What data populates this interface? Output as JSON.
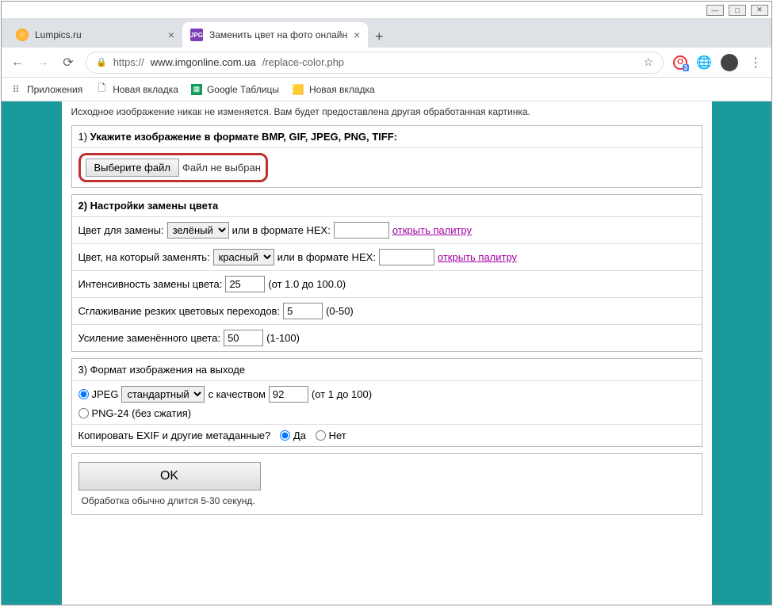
{
  "window": {
    "tabs": [
      {
        "title": "Lumpics.ru"
      },
      {
        "title": "Заменить цвет на фото онлайн"
      }
    ]
  },
  "address": {
    "scheme": "https://",
    "host": "www.imgonline.com.ua",
    "path": "/replace-color.php"
  },
  "bookmarks": {
    "apps": "Приложения",
    "items": [
      "Новая вкладка",
      "Google Таблицы",
      "Новая вкладка"
    ]
  },
  "page": {
    "cutoff": "Исходное изображение никак не изменяется. Вам будет предоставлена другая обработанная картинка.",
    "section1": {
      "title_prefix": "1) ",
      "title_bold": "Укажите изображение в формате BMP, GIF, JPEG, PNG, TIFF:",
      "choose_btn": "Выберите файл",
      "no_file": "Файл не выбран"
    },
    "section2": {
      "title": "2) Настройки замены цвета",
      "row1_label": "Цвет для замены:",
      "row1_select": "зелёный",
      "or_hex": "или в формате HEX:",
      "palette_link": "открыть палитру",
      "row2_label": "Цвет, на который заменять:",
      "row2_select": "красный",
      "row3_label": "Интенсивность замены цвета:",
      "row3_value": "25",
      "row3_range": "(от 1.0 до 100.0)",
      "row4_label": "Сглаживание резких цветовых переходов:",
      "row4_value": "5",
      "row4_range": "(0-50)",
      "row5_label": "Усиление заменённого цвета:",
      "row5_value": "50",
      "row5_range": "(1-100)"
    },
    "section3": {
      "title": "3) Формат изображения на выходе",
      "jpeg_label": "JPEG",
      "jpeg_select": "стандартный",
      "quality_label": "с качеством",
      "quality_value": "92",
      "quality_range": "(от 1 до 100)",
      "png_label": "PNG-24 (без сжатия)",
      "exif_label": "Копировать EXIF и другие метаданные?",
      "yes": "Да",
      "no": "Нет"
    },
    "submit": {
      "ok": "OK",
      "note": "Обработка обычно длится 5-30 секунд."
    }
  }
}
